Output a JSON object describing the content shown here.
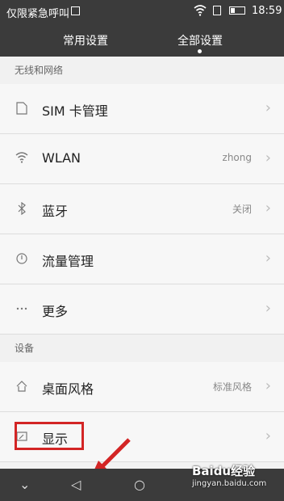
{
  "status_bar": {
    "carrier": "仅限紧急呼叫",
    "time": "18:59"
  },
  "top_tabs": [
    "常用设置",
    "全部设置"
  ],
  "sections": [
    {
      "header": "无线和网络",
      "items": [
        {
          "icon": "sim-card-icon",
          "label": "SIM 卡管理",
          "value": ""
        },
        {
          "icon": "wifi-icon",
          "label": "WLAN",
          "value": "zhong"
        },
        {
          "icon": "bluetooth-icon",
          "label": "蓝牙",
          "value": "关闭"
        },
        {
          "icon": "data-usage-icon",
          "label": "流量管理",
          "value": ""
        },
        {
          "icon": "more-icon",
          "label": "更多",
          "value": ""
        }
      ]
    },
    {
      "header": "设备",
      "items": [
        {
          "icon": "home-icon",
          "label": "桌面风格",
          "value": "标准风格"
        },
        {
          "icon": "display-icon",
          "label": "显示",
          "value": ""
        }
      ]
    }
  ],
  "watermark": {
    "brand": "Baidu经验",
    "url": "jingyan.baidu.com"
  },
  "colors": {
    "status_bar_bg": "#3b3b3b",
    "highlight_red": "#d32525"
  }
}
